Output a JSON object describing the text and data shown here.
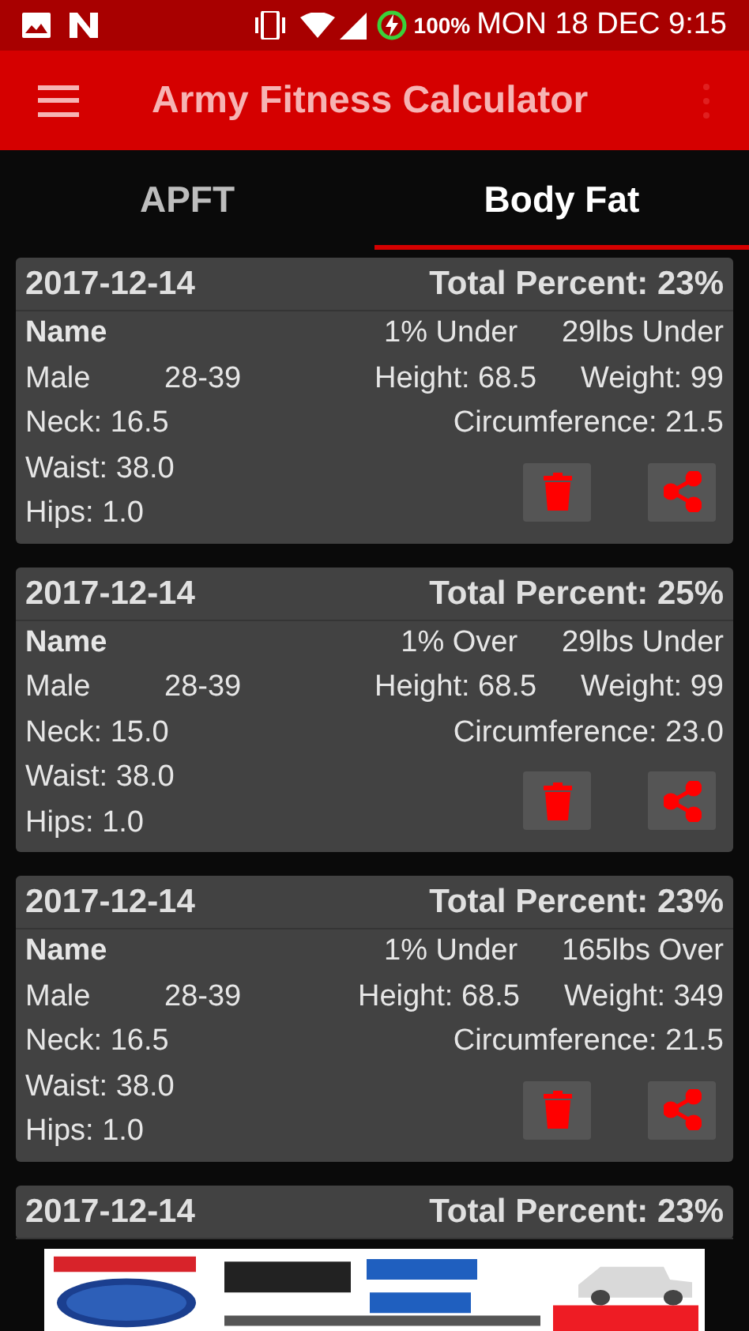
{
  "status_bar": {
    "battery": "100%",
    "datetime": "MON 18 DEC 9:15"
  },
  "app_bar": {
    "title": "Army Fitness Calculator"
  },
  "tabs": [
    {
      "label": "APFT",
      "selected": false
    },
    {
      "label": "Body Fat",
      "selected": true
    }
  ],
  "records": [
    {
      "date": "2017-12-14",
      "total": "Total Percent: 23%",
      "details": {
        "name": "Name",
        "percent_diff": "1% Under",
        "weight_diff": "29lbs Under",
        "sex": "Male",
        "age_group": "28-39",
        "height": "Height: 68.5",
        "weight": "Weight: 99",
        "neck": "Neck: 16.5",
        "circumference": "Circumference: 21.5",
        "waist": "Waist: 38.0",
        "hips": "Hips: 1.0"
      }
    },
    {
      "date": "2017-12-14",
      "total": "Total Percent: 25%",
      "details": {
        "name": "Name",
        "percent_diff": "1% Over",
        "weight_diff": "29lbs Under",
        "sex": "Male",
        "age_group": "28-39",
        "height": "Height: 68.5",
        "weight": "Weight: 99",
        "neck": "Neck: 15.0",
        "circumference": "Circumference: 23.0",
        "waist": "Waist: 38.0",
        "hips": "Hips: 1.0"
      }
    },
    {
      "date": "2017-12-14",
      "total": "Total Percent: 23%",
      "details": {
        "name": "Name",
        "percent_diff": "1% Under",
        "weight_diff": "165lbs Over",
        "sex": "Male",
        "age_group": "28-39",
        "height": "Height: 68.5",
        "weight": "Weight: 349",
        "neck": "Neck: 16.5",
        "circumference": "Circumference: 21.5",
        "waist": "Waist: 38.0",
        "hips": "Hips: 1.0"
      }
    },
    {
      "date": "2017-12-14",
      "total": "Total Percent: 23%"
    }
  ]
}
